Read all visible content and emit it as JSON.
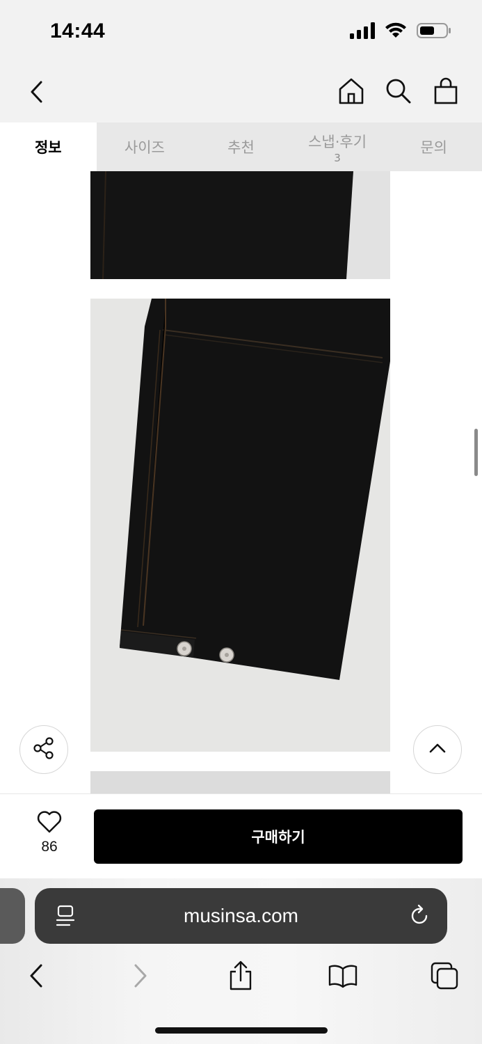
{
  "status_bar": {
    "time": "14:44",
    "icons": [
      "cellular-signal-icon",
      "wifi-icon",
      "battery-icon"
    ]
  },
  "nav": {
    "back_icon": "chevron-left-icon",
    "icons": [
      "home-icon",
      "search-icon",
      "shopping-bag-icon"
    ]
  },
  "tabs": [
    {
      "label": "정보",
      "active": true
    },
    {
      "label": "사이즈",
      "active": false
    },
    {
      "label": "추천",
      "active": false
    },
    {
      "label": "스냅·후기",
      "count": "3",
      "active": false
    },
    {
      "label": "문의",
      "active": false
    }
  ],
  "content": {
    "images": [
      "product-detail-photo",
      "product-detail-photo-hem",
      "product-detail-photo"
    ],
    "fab_left_icon": "share-icon",
    "fab_right_icon": "chevron-up-icon"
  },
  "purchase_bar": {
    "like_icon": "heart-icon",
    "like_count": "86",
    "buy_label": "구매하기"
  },
  "browser": {
    "url": "musinsa.com",
    "left_icon": "reader-icon",
    "right_icon": "reload-icon",
    "toolbar_icons": [
      "back-icon",
      "forward-icon",
      "share-icon",
      "bookmarks-icon",
      "tabs-icon"
    ]
  },
  "colors": {
    "header_bg": "#f2f2f2",
    "tab_bar_bg": "#e8e8e8",
    "buy_button_bg": "#000000",
    "address_bar_bg": "#3a3a3a"
  }
}
